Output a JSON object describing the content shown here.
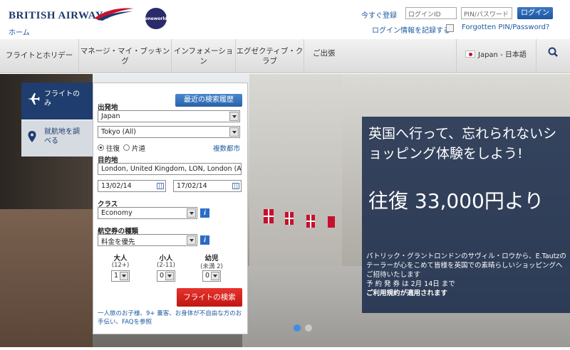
{
  "header": {
    "logo_text": "BRITISH AIRWAYS",
    "home_link": "ホーム",
    "oneworld_label": "oneworld",
    "register_link": "今すぐ登録",
    "login_id_placeholder": "ログインID",
    "pin_placeholder": "PIN/パスワード",
    "login_button": "ログイン",
    "remember_label": "ログイン情報を記録する",
    "forgot_link": "Forgotten PIN/Password?"
  },
  "nav": {
    "items": [
      {
        "label": "フライトとホリデー"
      },
      {
        "label": "マネージ・マイ・ブッキング"
      },
      {
        "label": "インフォメーション"
      },
      {
        "label": "エグゼクティブ・クラブ"
      },
      {
        "label": "ご出張"
      }
    ],
    "language": "Japan - 日本語"
  },
  "booking": {
    "tabs": [
      {
        "label": "フライトのみ",
        "icon": "airplane-icon"
      },
      {
        "label": "就航地を調べる",
        "icon": "map-pin-icon"
      }
    ],
    "recent_button": "最近の検索履歴",
    "origin_label": "出発地",
    "origin_country": "Japan",
    "origin_city": "Tokyo (All)",
    "trip_return": "往復",
    "trip_oneway": "片道",
    "multi_city_link": "複数都市",
    "destination_label": "目的地",
    "destination_value": "London, United Kingdom, LON, London (All A",
    "depart_date": "13/02/14",
    "return_date": "17/02/14",
    "class_label": "クラス",
    "class_value": "Economy",
    "fare_label": "航空券の種類",
    "fare_value": "料金を優先",
    "adults_label": "大人",
    "adults_sub": "(12+)",
    "adults_value": "1",
    "children_label": "小人",
    "children_sub": "(2-11)",
    "children_value": "0",
    "infants_label": "幼児",
    "infants_sub": "(未満 2)",
    "infants_value": "0",
    "search_button": "フライトの検索",
    "footnote": "一人旅のお子様、9+ 乗客、お身体が不自由な方のお手伝い、FAQを参照"
  },
  "promo": {
    "headline": "英国へ行って、忘れられないショッピング体験をしよう!",
    "price": "往復 33,000円より",
    "body": "パトリック・グラントロンドンのサヴィル・ロウから、E.Tautzのテーラーが心をこめて皆様を英国での素晴らしいショッピングへご招待いたします",
    "period": "予 約 発 券 は 2月 14日 まで",
    "terms": "ご利用規約が適用されます"
  },
  "colors": {
    "brand_navy": "#1f3d6e",
    "link_blue": "#1b5aa0",
    "search_red": "#d42420",
    "carousel_active": "#3c8ee0"
  }
}
